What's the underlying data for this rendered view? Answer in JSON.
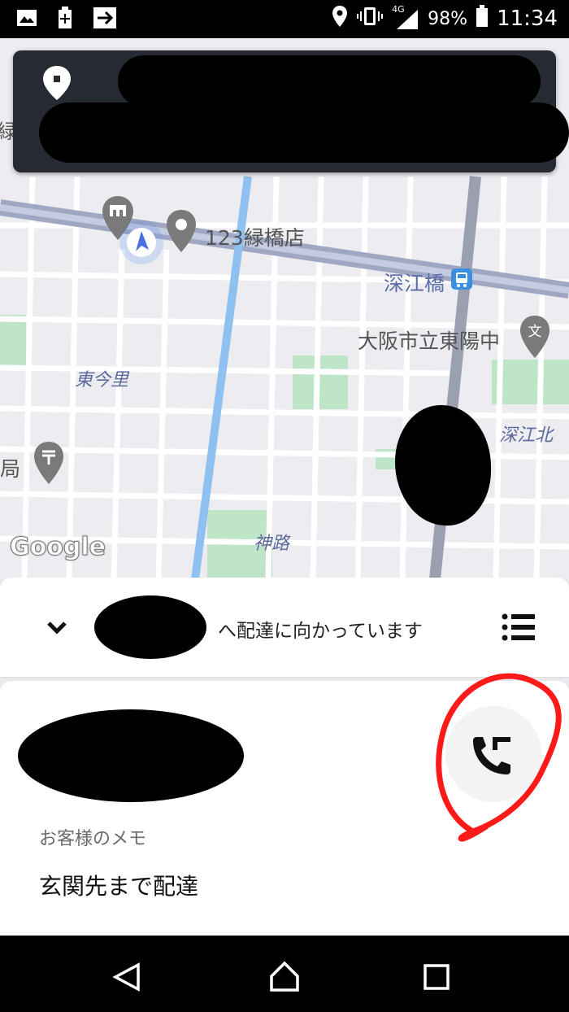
{
  "status_bar": {
    "network": "4G",
    "battery": "98%",
    "time": "11:34"
  },
  "map": {
    "labels": {
      "store": "123緑橋店",
      "station": "深江橋",
      "school": "大阪市立東陽中",
      "district_higashi_imazato": "東今里",
      "district_fukae_kita": "深江北",
      "post_office": "局",
      "district_jinji": "神路",
      "google": "Google"
    },
    "left_edge_fragments": [
      "緑"
    ]
  },
  "delivery": {
    "status": "へ配達に向かっています"
  },
  "customer": {
    "memo_label": "お客様のメモ",
    "memo_text": "玄関先まで配達"
  },
  "colors": {
    "card_dark": "#262a33",
    "accent_blue": "#4285f4",
    "park_green": "#bfe5c9",
    "annotation_red": "#ff1a1a"
  }
}
